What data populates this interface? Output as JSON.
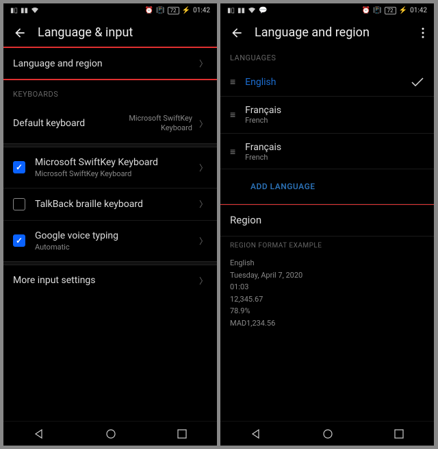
{
  "left": {
    "status": {
      "time": "01:42",
      "battery": "72"
    },
    "header_title": "Language & input",
    "language_region": "Language and region",
    "keyboards_label": "KEYBOARDS",
    "default_kb": {
      "title": "Default keyboard",
      "value_line1": "Microsoft SwiftKey",
      "value_line2": "Keyboard"
    },
    "kb1": {
      "title": "Microsoft SwiftKey Keyboard",
      "sub": "Microsoft SwiftKey Keyboard"
    },
    "kb2": {
      "title": "TalkBack braille keyboard"
    },
    "kb3": {
      "title": "Google voice typing",
      "sub": "Automatic"
    },
    "more_input": "More input settings"
  },
  "right": {
    "status": {
      "time": "01:42",
      "battery": "72"
    },
    "header_title": "Language and region",
    "languages_label": "LANGUAGES",
    "langs": [
      {
        "name": "English",
        "sub": "",
        "selected": true
      },
      {
        "name": "Français",
        "sub": "French",
        "selected": false
      },
      {
        "name": "Français",
        "sub": "French",
        "selected": false
      }
    ],
    "add_language": "ADD LANGUAGE",
    "region_label": "Region",
    "region_example_label": "REGION FORMAT EXAMPLE",
    "region_example": {
      "lang": "English",
      "date": "Tuesday, April 7, 2020",
      "time": "01:03",
      "num": "12,345.67",
      "pct": "78.9%",
      "currency": "MAD1,234.56"
    }
  }
}
